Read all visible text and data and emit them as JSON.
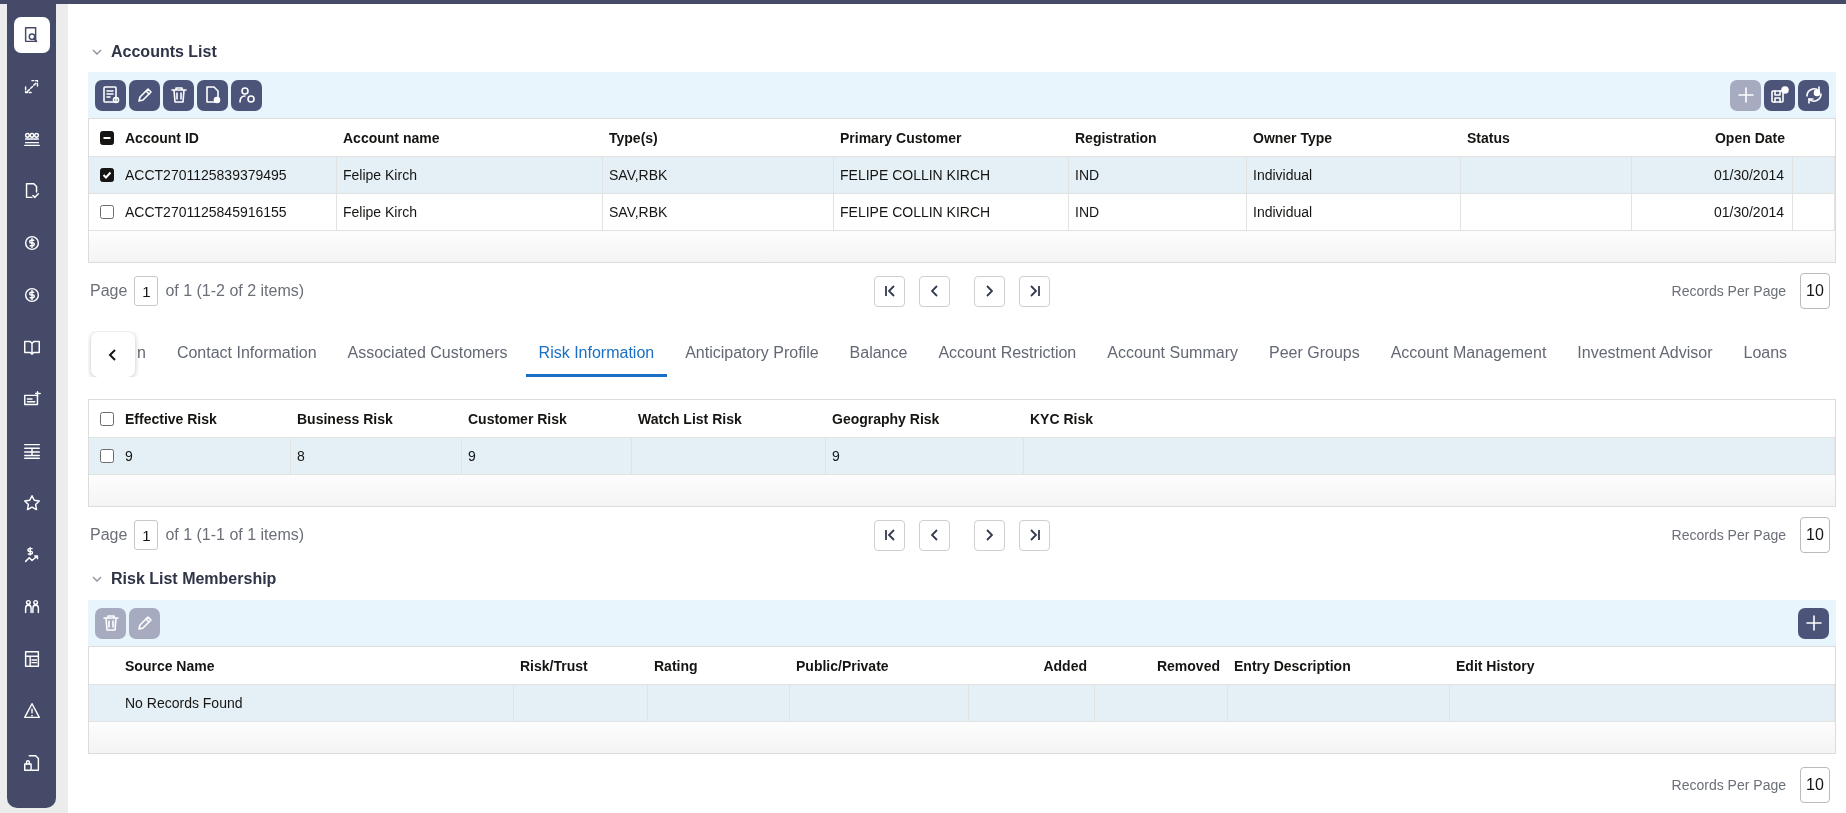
{
  "sidebar": {
    "items": [
      {
        "selected": true
      },
      {
        "selected": false
      },
      {
        "selected": false
      },
      {
        "selected": false
      },
      {
        "selected": false
      },
      {
        "selected": false
      },
      {
        "selected": false
      },
      {
        "selected": false
      },
      {
        "selected": false
      },
      {
        "selected": false
      },
      {
        "selected": false
      },
      {
        "selected": false
      },
      {
        "selected": false
      },
      {
        "selected": false
      },
      {
        "selected": false
      }
    ]
  },
  "accounts_list": {
    "title": "Accounts List",
    "expanded": true,
    "toolbar": {
      "left": [
        {
          "kind": "view",
          "disabled": false
        },
        {
          "kind": "edit",
          "disabled": false
        },
        {
          "kind": "delete",
          "disabled": false
        },
        {
          "kind": "document",
          "disabled": false
        },
        {
          "kind": "user",
          "disabled": false
        }
      ],
      "right": [
        {
          "kind": "add",
          "disabled": true
        },
        {
          "kind": "save_settings",
          "disabled": false
        },
        {
          "kind": "refresh_settings",
          "disabled": false
        }
      ]
    },
    "table": {
      "select_all": {
        "checked": false,
        "indeterminate": true
      },
      "columns": [
        {
          "label": "Account ID",
          "right_aligned": false
        },
        {
          "label": "Account name",
          "right_aligned": false
        },
        {
          "label": "Type(s)",
          "right_aligned": false
        },
        {
          "label": "Primary Customer",
          "right_aligned": false
        },
        {
          "label": "Registration",
          "right_aligned": false
        },
        {
          "label": "Owner Type",
          "right_aligned": false
        },
        {
          "label": "Status",
          "right_aligned": false
        },
        {
          "label": "Open Date",
          "right_aligned": true
        }
      ],
      "rows": [
        {
          "checked": true,
          "highlighted": true,
          "cells": [
            "ACCT2701125839379495",
            "Felipe Kirch",
            "SAV,RBK",
            "FELIPE COLLIN KIRCH",
            "IND",
            "Individual",
            null,
            "01/30/2014"
          ]
        },
        {
          "checked": false,
          "highlighted": false,
          "cells": [
            "ACCT2701125845916155",
            "Felipe Kirch",
            "SAV,RBK",
            "FELIPE COLLIN KIRCH",
            "IND",
            "Individual",
            null,
            "01/30/2014"
          ]
        }
      ]
    },
    "pagination": {
      "page_label": "Page",
      "page": "1",
      "summary": "of 1 (1-2 of 2 items)",
      "records_per_page_label": "Records Per Page",
      "records_per_page": "10"
    }
  },
  "tabs": [
    {
      "label": "n",
      "selected": false
    },
    {
      "label": "Contact Information",
      "selected": false
    },
    {
      "label": "Associated Customers",
      "selected": false
    },
    {
      "label": "Risk Information",
      "selected": true
    },
    {
      "label": "Anticipatory Profile",
      "selected": false
    },
    {
      "label": "Balance",
      "selected": false
    },
    {
      "label": "Account Restriction",
      "selected": false
    },
    {
      "label": "Account Summary",
      "selected": false
    },
    {
      "label": "Peer Groups",
      "selected": false
    },
    {
      "label": "Account Management",
      "selected": false
    },
    {
      "label": "Investment Advisor",
      "selected": false
    },
    {
      "label": "Loans",
      "selected": false
    }
  ],
  "risk_information": {
    "table": {
      "select_all": {
        "checked": false,
        "indeterminate": false
      },
      "columns": [
        {
          "label": "Effective Risk",
          "right_aligned": false
        },
        {
          "label": "Business Risk",
          "right_aligned": false
        },
        {
          "label": "Customer Risk",
          "right_aligned": false
        },
        {
          "label": "Watch List Risk",
          "right_aligned": false
        },
        {
          "label": "Geography Risk",
          "right_aligned": false
        },
        {
          "label": "KYC Risk",
          "right_aligned": false
        }
      ],
      "rows": [
        {
          "checked": false,
          "highlighted": true,
          "cells": [
            "9",
            "8",
            "9",
            null,
            "9",
            null
          ]
        }
      ]
    },
    "pagination": {
      "page_label": "Page",
      "page": "1",
      "summary": "of 1 (1-1 of 1 items)",
      "records_per_page_label": "Records Per Page",
      "records_per_page": "10"
    }
  },
  "risk_list_membership": {
    "title": "Risk List Membership",
    "expanded": true,
    "toolbar": {
      "left": [
        {
          "kind": "delete",
          "disabled": true
        },
        {
          "kind": "edit",
          "disabled": true
        }
      ],
      "right": [
        {
          "kind": "add",
          "disabled": false
        }
      ]
    },
    "table": {
      "columns": [
        {
          "label": "Source Name",
          "right_aligned": false
        },
        {
          "label": "Risk/Trust",
          "right_aligned": false
        },
        {
          "label": "Rating",
          "right_aligned": false
        },
        {
          "label": "Public/Private",
          "right_aligned": false
        },
        {
          "label": "Added",
          "right_aligned": true
        },
        {
          "label": "Removed",
          "right_aligned": true
        },
        {
          "label": "Entry Description",
          "right_aligned": false
        },
        {
          "label": "Edit History",
          "right_aligned": false
        }
      ],
      "rows": [
        {
          "highlighted": true,
          "cells": [
            "No Records Found",
            null,
            null,
            null,
            null,
            null,
            null,
            null
          ]
        }
      ]
    },
    "pagination": {
      "records_per_page_label": "Records Per Page",
      "records_per_page": "10"
    }
  }
}
